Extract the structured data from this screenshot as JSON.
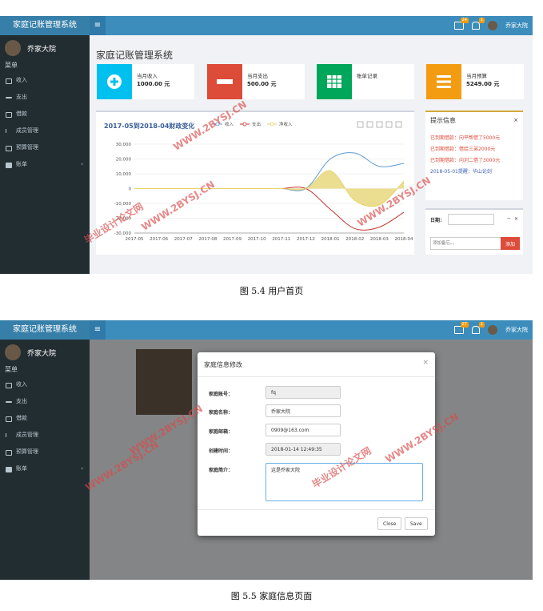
{
  "app": {
    "brand": "家庭记账管理系统",
    "toggle_icon": "bars-icon",
    "user": "乔家大院",
    "menu_header": "菜单",
    "notifications": {
      "messages": "24",
      "alerts": "1"
    },
    "nav": [
      {
        "label": "收入",
        "icon": "money-icon"
      },
      {
        "label": "支出",
        "icon": "minus-icon"
      },
      {
        "label": "借款",
        "icon": "card-icon"
      },
      {
        "label": "成员管理",
        "icon": "upload-icon"
      },
      {
        "label": "预算管理",
        "icon": "book-icon"
      },
      {
        "label": "账单",
        "icon": "folder-icon",
        "chevron": "‹"
      }
    ]
  },
  "shot2_badges": {
    "messages": "27",
    "alerts": "1"
  },
  "home": {
    "title": "家庭记账管理系统",
    "stats": [
      {
        "label": "当月收入",
        "value": "1000.00 元",
        "color": "#00c0ef",
        "icon": "plus-icon"
      },
      {
        "label": "当月支出",
        "value": "500.00 元",
        "color": "#dd4b39",
        "icon": "minus-icon"
      },
      {
        "label": "账单记录",
        "value": "",
        "color": "#00a65a",
        "icon": "table-icon"
      },
      {
        "label": "当月预算",
        "value": "5249.00 元",
        "color": "#f39c12",
        "icon": "list-icon"
      }
    ],
    "notice": {
      "title": "提示信息",
      "close": "×",
      "lines": [
        {
          "text": "已到期借款：向平帮借了5000元",
          "color": "#dd4b39"
        },
        {
          "text": "已到期借款：借给三弟2000元",
          "color": "#dd4b39"
        },
        {
          "text": "已到期借款：向刘二借了3000元",
          "color": "#dd4b39"
        },
        {
          "text": "2018-05-01提醒：华山论剑",
          "color": "#3c5fb8"
        }
      ]
    },
    "date_widget": {
      "label": "日期：",
      "minimize": "－",
      "close": "×",
      "memo_placeholder": "添加备忘。。",
      "add_button": "添加"
    }
  },
  "chart_data": {
    "type": "line",
    "title": "2017-05到2018-04财政变化",
    "categories": [
      "2017-05",
      "2017-06",
      "2017-07",
      "2017-08",
      "2017-09",
      "2017-10",
      "2017-11",
      "2017-12",
      "2018-01",
      "2018-02",
      "2018-03",
      "2018-04"
    ],
    "series": [
      {
        "name": "收入",
        "color": "#5b9bd5",
        "values": [
          0,
          0,
          0,
          0,
          0,
          0,
          0,
          0,
          20000,
          24000,
          15000,
          17000
        ]
      },
      {
        "name": "支出",
        "color": "#c23531",
        "values": [
          0,
          0,
          0,
          0,
          0,
          0,
          0,
          0,
          -14000,
          -27000,
          -26000,
          -16000
        ]
      },
      {
        "name": "净收入",
        "color": "#e6d36b",
        "values": [
          0,
          0,
          0,
          0,
          0,
          0,
          0,
          0,
          12000,
          -8000,
          -11000,
          5000
        ]
      }
    ],
    "ylim": [
      -30000,
      30000
    ],
    "yticks": [
      "30,000",
      "20,000",
      "10,000",
      "0",
      "-10,000",
      "-20,000",
      "-30,000"
    ],
    "toolbox_icons": [
      "download-icon",
      "data-view-icon",
      "line-icon",
      "bar-icon",
      "refresh-icon"
    ],
    "grid": true,
    "legend": "top-center"
  },
  "captions": {
    "fig1": "图 5.4  用户首页",
    "fig2": "图 5.5  家庭信息页面"
  },
  "watermarks": {
    "text1": "WWW.2BYSJ.CN",
    "text2": "毕业设计论文网"
  },
  "modal": {
    "title": "家庭信息修改",
    "close": "×",
    "fields": [
      {
        "label": "家庭账号：",
        "value": "fq"
      },
      {
        "label": "家庭名称：",
        "value": "乔家大院"
      },
      {
        "label": "家庭邮箱：",
        "value": "0909@163.com"
      },
      {
        "label": "创建时间：",
        "value": "2018-01-14 12:49:35"
      },
      {
        "label": "家庭简介：",
        "value": "这是乔家大院"
      }
    ],
    "close_button": "Close",
    "save_button": "Save"
  }
}
